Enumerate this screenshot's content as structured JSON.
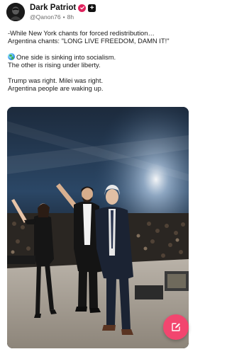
{
  "post": {
    "author": {
      "display_name": "Dark Patriot",
      "handle": "@Qanon76",
      "time_ago": "8h",
      "verified_icon": "verified-badge-icon",
      "badge_icon": "plus-badge-icon",
      "badge_glyph": "+",
      "accent_color": "#e0245e"
    },
    "text": {
      "line1": "-While New York chants for forced redistribution…",
      "line2": "Argentina chants: \"LONG LIVE FREEDOM, DAMN IT!\"",
      "line3": "One side is sinking into socialism.",
      "line3_icon": "globe-icon",
      "line4": "The other is rising under liberty.",
      "line5": "Trump was right. Milei was right.",
      "line6": "Argentina people are waking up."
    },
    "image": {
      "description_icon": "concert-stage-photo"
    }
  },
  "fab": {
    "icon": "compose-icon",
    "color": "#f2466f"
  }
}
